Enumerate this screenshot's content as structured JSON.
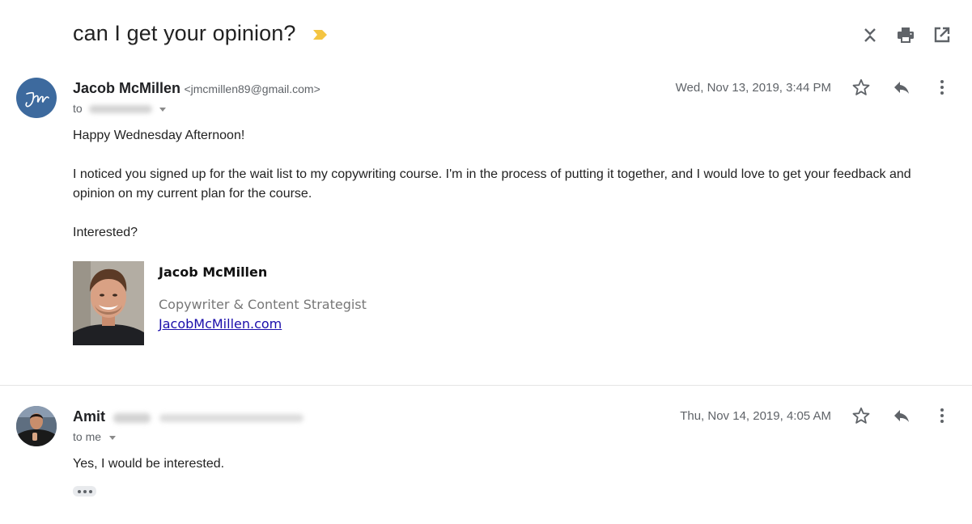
{
  "thread": {
    "subject": "can I get your opinion?"
  },
  "toolbar": {
    "icons": [
      "collapse-all-icon",
      "print-icon",
      "open-in-new-window-icon"
    ]
  },
  "messages": [
    {
      "sender_name": "Jacob McMillen",
      "sender_email": "<jmcmillen89@gmail.com>",
      "to_label": "to",
      "date": "Wed, Nov 13, 2019, 3:44 PM",
      "body": {
        "greeting": "Happy Wednesday Afternoon!",
        "paragraph_1": "I noticed you signed up for the wait list to my copywriting course. I'm in the process of putting it together, and I would love to get your feedback and opinion on my current plan for the course.",
        "paragraph_2": "Interested?"
      },
      "signature": {
        "name": "Jacob McMillen",
        "title": "Copywriter & Content Strategist",
        "link": "JacobMcMillen.com"
      }
    },
    {
      "sender_name": "Amit",
      "to_label": "to me",
      "date": "Thu, Nov 14, 2019, 4:05 AM",
      "body": {
        "text": "Yes, I would be interested."
      }
    }
  ],
  "colors": {
    "important_marker": "#f4c542",
    "link": "#1a0dab",
    "avatar_bg": "#3d6a9e"
  }
}
